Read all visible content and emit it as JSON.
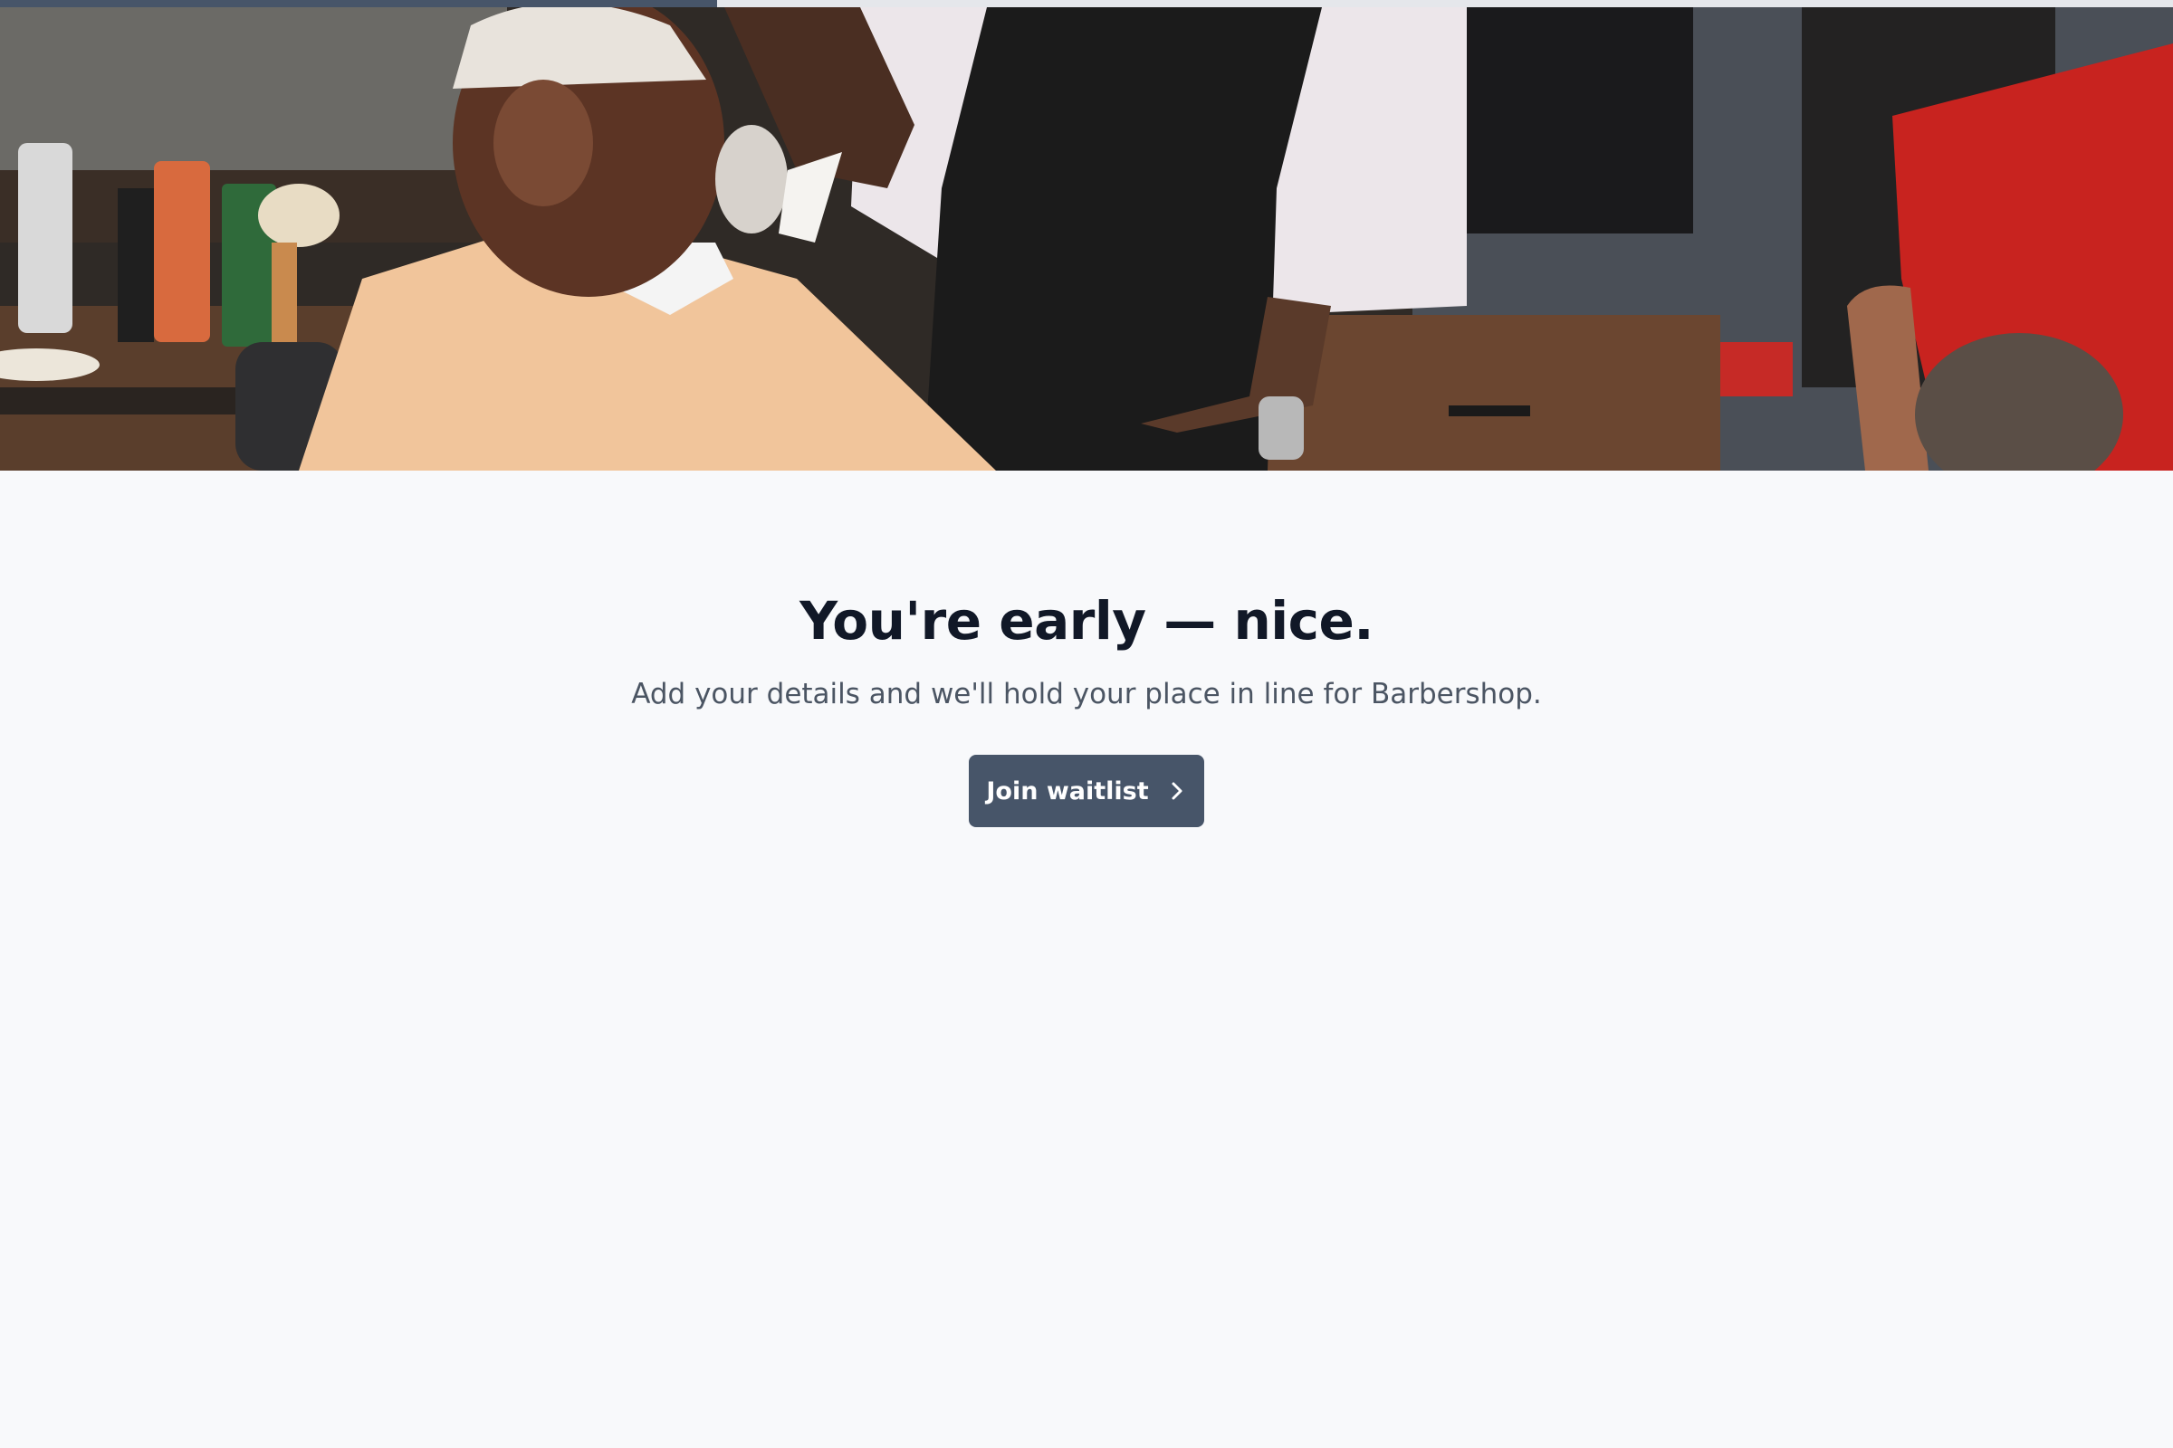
{
  "progress": {
    "fraction": 0.33,
    "fill_color": "#475569",
    "track_color": "#e5e7eb"
  },
  "hero": {
    "icon": "barbershop-photo"
  },
  "main": {
    "headline": "You're early — nice.",
    "subtext": "Add your details and we'll hold your place in line for Barbershop.",
    "cta_label": "Join waitlist",
    "cta_icon": "chevron-right-icon",
    "cta_color": "#475569"
  }
}
